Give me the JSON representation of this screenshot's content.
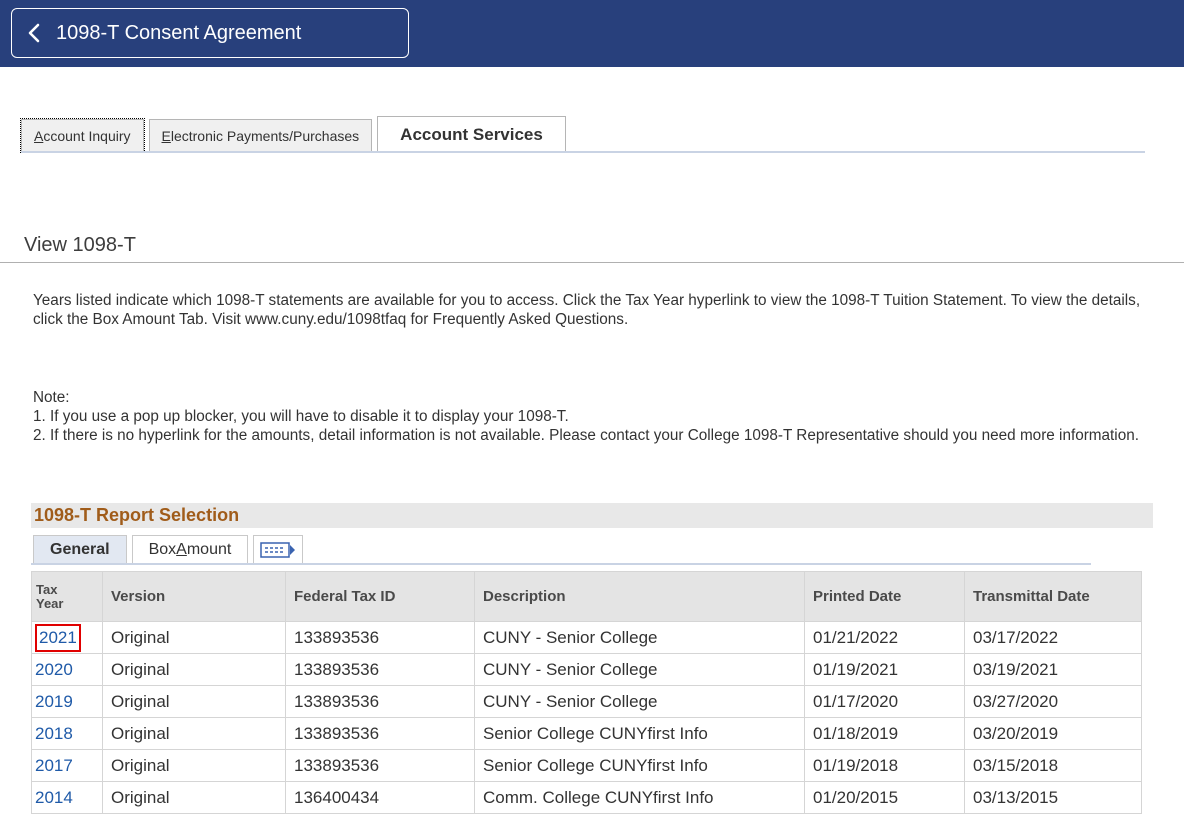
{
  "header": {
    "back_label": "1098-T Consent Agreement"
  },
  "top_tabs": [
    {
      "label_u": "A",
      "label_rest": "ccount Inquiry"
    },
    {
      "label_u": "E",
      "label_rest": "lectronic Payments/Purchases"
    },
    {
      "label": "Account Services"
    }
  ],
  "section": {
    "title": "View 1098-T",
    "intro": "Years listed indicate which 1098-T statements are available for you to access. Click the Tax Year hyperlink to view the 1098-T Tuition Statement.  To view the details, click the Box Amount Tab.  Visit www.cuny.edu/1098tfaq for Frequently Asked Questions.",
    "note_label": "Note:",
    "note_1": "1. If you use a pop up blocker, you will have to disable it to display your 1098-T.",
    "note_2": "2. If there is no hyperlink for the amounts, detail information is not available.  Please contact your College 1098-T Representative should you need more information."
  },
  "report": {
    "title": "1098-T Report Selection",
    "grid_tabs": {
      "general": "General",
      "box_amount_pre": "Box ",
      "box_amount_u": "A",
      "box_amount_post": "mount"
    },
    "columns": {
      "tax_year_1": "Tax",
      "tax_year_2": "Year",
      "version": "Version",
      "federal_tax_id": "Federal Tax ID",
      "description": "Description",
      "printed_date": "Printed Date",
      "transmittal_date": "Transmittal Date"
    },
    "rows": [
      {
        "year": "2021",
        "version": "Original",
        "fed_id": "133893536",
        "description": "CUNY - Senior College",
        "printed": "01/21/2022",
        "transmittal": "03/17/2022"
      },
      {
        "year": "2020",
        "version": "Original",
        "fed_id": "133893536",
        "description": "CUNY - Senior College",
        "printed": "01/19/2021",
        "transmittal": "03/19/2021"
      },
      {
        "year": "2019",
        "version": "Original",
        "fed_id": "133893536",
        "description": "CUNY - Senior College",
        "printed": "01/17/2020",
        "transmittal": "03/27/2020"
      },
      {
        "year": "2018",
        "version": "Original",
        "fed_id": "133893536",
        "description": "Senior College CUNYfirst Info",
        "printed": "01/18/2019",
        "transmittal": "03/20/2019"
      },
      {
        "year": "2017",
        "version": "Original",
        "fed_id": "133893536",
        "description": "Senior College CUNYfirst Info",
        "printed": "01/19/2018",
        "transmittal": "03/15/2018"
      },
      {
        "year": "2014",
        "version": "Original",
        "fed_id": "136400434",
        "description": "Comm. College CUNYfirst Info",
        "printed": "01/20/2015",
        "transmittal": "03/13/2015"
      }
    ]
  },
  "colors": {
    "header_bg": "#28407c",
    "link": "#1f5aa8",
    "report_title": "#a05c1a",
    "highlight_box": "#e00000"
  }
}
